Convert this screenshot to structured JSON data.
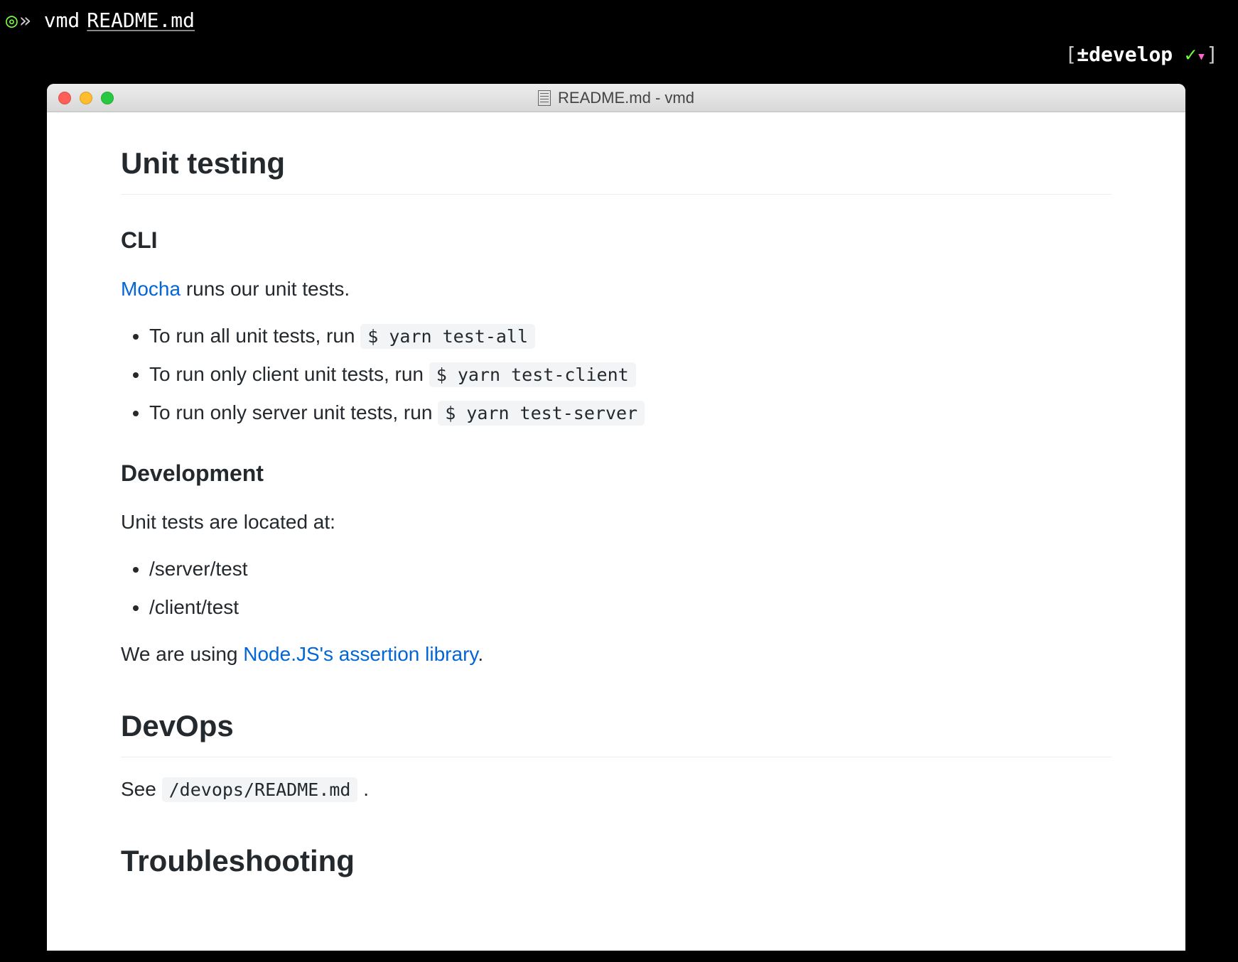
{
  "terminal": {
    "prompt_symbol": "◎»",
    "command": "vmd",
    "argument": "README.md",
    "status_prefix": "[",
    "status_pm": "±",
    "branch": "develop",
    "check": "✓",
    "tri": "▾",
    "status_suffix": "]"
  },
  "window": {
    "title": "README.md - vmd"
  },
  "doc": {
    "h1_unit": "Unit testing",
    "h2_cli": "CLI",
    "mocha_link": "Mocha",
    "mocha_tail": " runs our unit tests.",
    "li1_pre": "To run all unit tests, run ",
    "li1_code": "$ yarn test-all",
    "li2_pre": "To run only client unit tests, run ",
    "li2_code": "$ yarn test-client",
    "li3_pre": "To run only server unit tests, run ",
    "li3_code": "$ yarn test-server",
    "h2_dev": "Development",
    "dev_p": "Unit tests are located at:",
    "dev_li1": "/server/test",
    "dev_li2": "/client/test",
    "assert_pre": "We are using ",
    "assert_link": "Node.JS's assertion library",
    "assert_tail": ".",
    "h1_devops": "DevOps",
    "devops_pre": "See ",
    "devops_code": "/devops/README.md",
    "devops_tail": " .",
    "h1_trouble": "Troubleshooting"
  }
}
